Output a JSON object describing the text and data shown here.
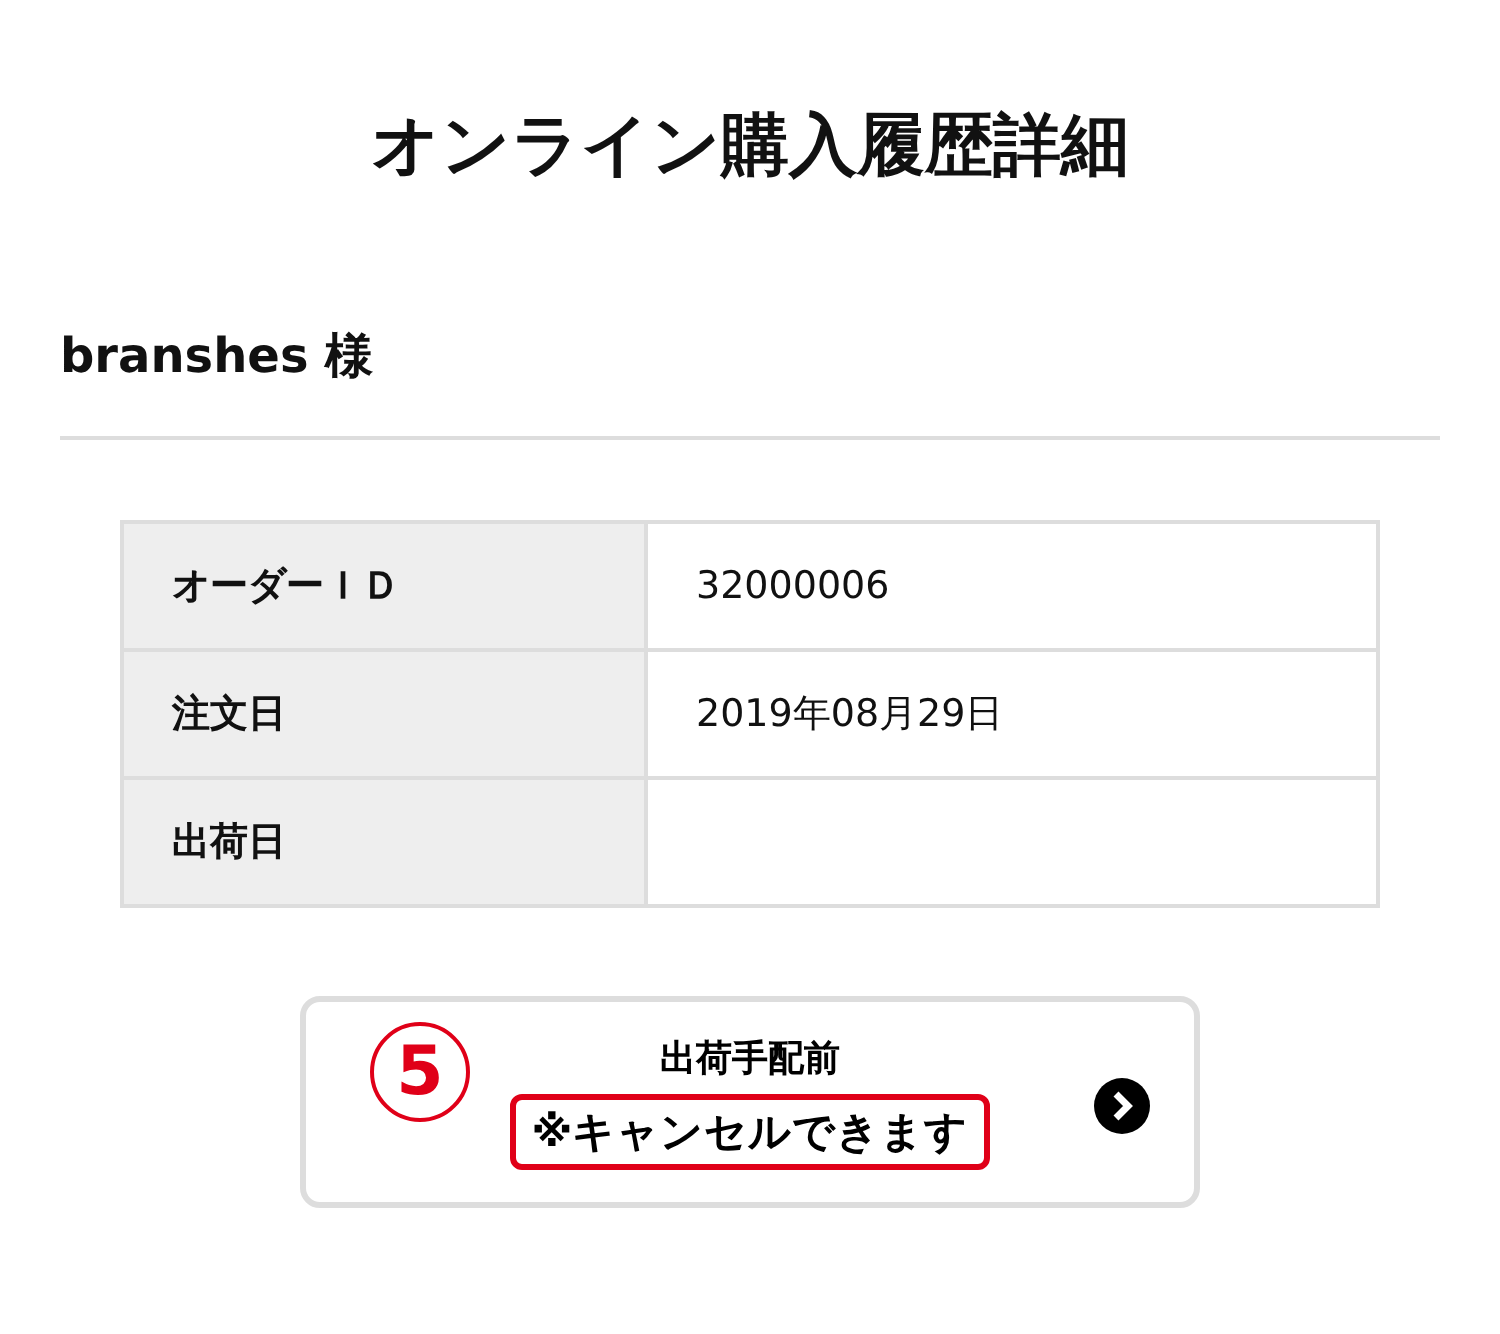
{
  "page_title": "オンライン購入履歴詳細",
  "customer": {
    "name": "branshes 様"
  },
  "details": [
    {
      "label": "オーダーＩＤ",
      "value": "32000006"
    },
    {
      "label": "注文日",
      "value": "2019年08月29日"
    },
    {
      "label": "出荷日"
    }
  ],
  "status_button": {
    "step_number": "5",
    "status": "出荷手配前",
    "note": "※キャンセルできます",
    "note_highlighted": true
  }
}
